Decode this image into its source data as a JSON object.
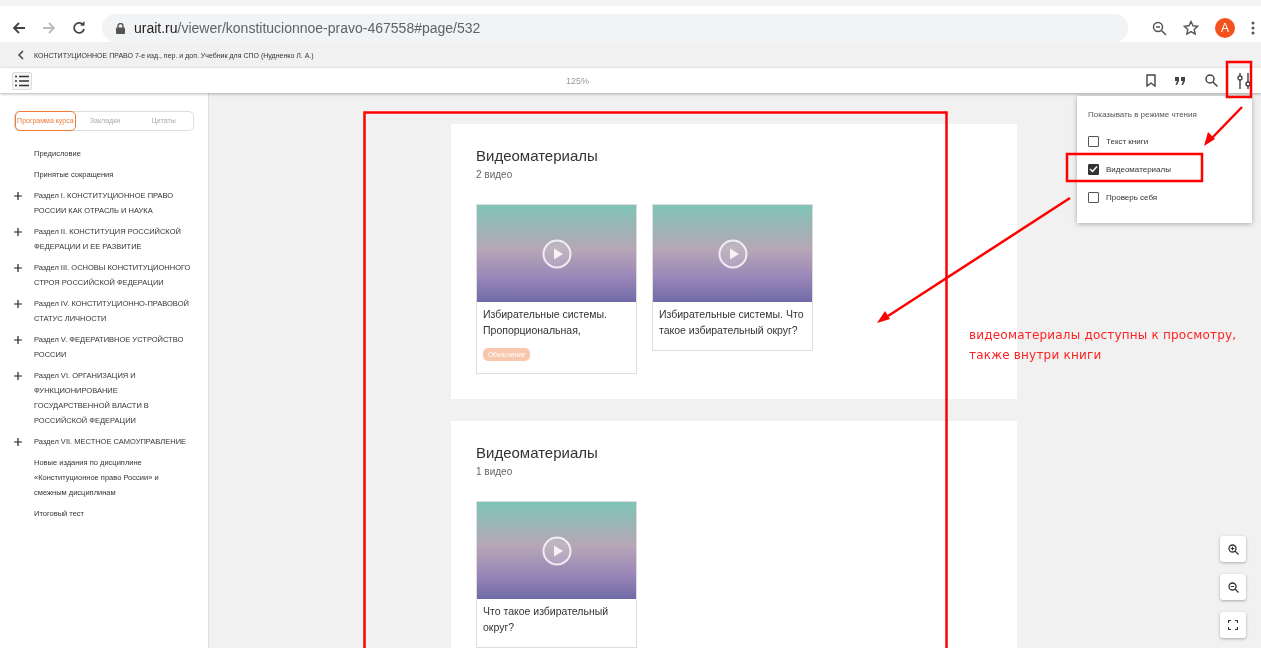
{
  "browser": {
    "url_host": "urait.ru",
    "url_path": "/viewer/konstitucionnoe-pravo-467558#page/532",
    "avatar": "A",
    "forward_disabled": true
  },
  "book_title": "КОНСТИТУЦИОННОЕ ПРАВО 7-е изд., пер. и доп. Учебник для СПО (Нудненко Л. А.)",
  "zoom": "125%",
  "sidebar": {
    "tabs": [
      {
        "label": "Программа курса",
        "selected": true
      },
      {
        "label": "Закладки",
        "selected": false
      },
      {
        "label": "Цитаты",
        "selected": false
      }
    ],
    "items": [
      {
        "label": "Предисловие",
        "expandable": false
      },
      {
        "label": "Принятые сокращения",
        "expandable": false
      },
      {
        "label": "Раздел I. КОНСТИТУЦИОННОЕ ПРАВО РОССИИ КАК ОТРАСЛЬ И НАУКА",
        "expandable": true
      },
      {
        "label": "Раздел II. КОНСТИТУЦИЯ РОССИЙСКОЙ ФЕДЕРАЦИИ И ЕЕ РАЗВИТИЕ",
        "expandable": true
      },
      {
        "label": "Раздел III. ОСНОВЫ КОНСТИТУЦИОННОГО СТРОЯ РОССИЙСКОЙ ФЕДЕРАЦИИ",
        "expandable": true
      },
      {
        "label": "Раздел IV. КОНСТИТУЦИОННО-ПРАВОВОЙ СТАТУС ЛИЧНОСТИ",
        "expandable": true
      },
      {
        "label": "Раздел V. ФЕДЕРАТИВНОЕ УСТРОЙСТВО РОССИИ",
        "expandable": true
      },
      {
        "label": "Раздел VI. ОРГАНИЗАЦИЯ И ФУНКЦИОНИРОВАНИЕ ГОСУДАРСТВЕННОЙ ВЛАСТИ В РОССИЙСКОЙ ФЕДЕРАЦИИ",
        "expandable": true
      },
      {
        "label": "Раздел VII. МЕСТНОЕ САМОУПРАВЛЕНИЕ",
        "expandable": true
      },
      {
        "label": "Новые издания по дисциплине «Конституционное право России» и смежным дисциплинам",
        "expandable": false
      },
      {
        "label": "Итоговый тест",
        "expandable": false
      }
    ]
  },
  "reading_menu": {
    "title": "Показывать в режиме чтения",
    "options": [
      {
        "label": "Текст книги",
        "checked": false
      },
      {
        "label": "Видеоматериалы",
        "checked": true
      },
      {
        "label": "Проверь себя",
        "checked": false
      }
    ]
  },
  "sections": [
    {
      "title": "Видеоматериалы",
      "count": "2 видео",
      "videos": [
        {
          "title": "Избирательные системы. Пропорциональная,",
          "tag": "Объяснение"
        },
        {
          "title": "Избирательные системы. Что такое избирательный округ?"
        }
      ]
    },
    {
      "title": "Видеоматериалы",
      "count": "1 видео",
      "videos": [
        {
          "title": "Что такое избирательный округ?"
        }
      ]
    }
  ],
  "annotation": {
    "text": "видеоматериалы доступны к просмотру,\n также внутри книги"
  }
}
